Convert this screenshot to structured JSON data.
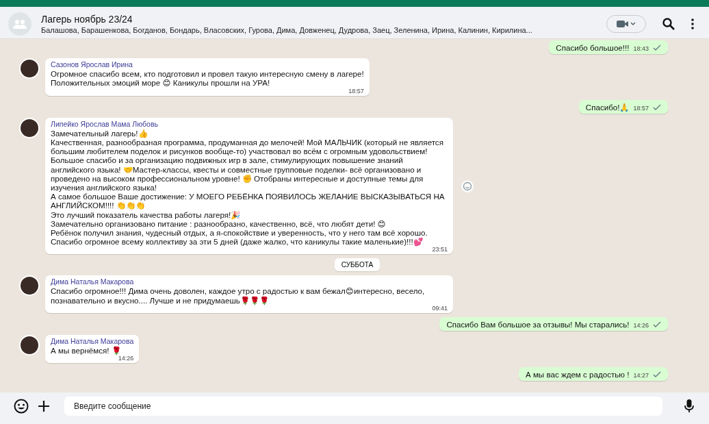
{
  "header": {
    "title": "Лагерь ноябрь 23/24",
    "members": "Балашова, Барашенкова, Богданов, Бондарь, Власовских, Гурова, Дима, Довженец, Дудрова, Заец, Зеленина, Ирина, Калинин, Кирилина..."
  },
  "messages": [
    {
      "kind": "outgoing",
      "text": "Спасибо большое!!!",
      "time": "18:43",
      "read": false
    },
    {
      "kind": "incoming",
      "sender": "Сазонов Ярослав Ирина",
      "text": "Огромное спасибо всем, кто подготовил и провел такую интересную смену в лагере!\nПоложительных эмоций море 😊 Каникулы прошли на УРА!",
      "time": "18:57"
    },
    {
      "kind": "outgoing",
      "text": "Спасибо!🙏",
      "time": "18:57",
      "read": false
    },
    {
      "kind": "incoming",
      "sender": "Липейко Ярослав Мама Любовь",
      "text": "Замечательный лагерь!👍\nКачественная, разнообразная программа, продуманная до мелочей! Мой МАЛЬЧИК (который не является большим любителем поделок и рисунков вообще-то) участвовал во всём с огромным удовольствием! Большое спасибо и за организацию подвижных игр в зале, стимулирующих повышение знаний английского языка!  🤝Мастер-классы, квесты и совместные групповые поделки- всё организовано и проведено на высоком профессиональном уровне! ✊ Отобраны интересные и доступные темы для изучения английского языка!\nА самое большое Ваше достижение: У МОЕГО РЕБЁНКА ПОЯВИЛОСЬ ЖЕЛАНИЕ ВЫСКАЗЫВАТЬСЯ НА АНГЛИЙСКОМ!!!! 👏👏👏\nЭто  лучший показатель качества работы лагеря!🎉\nЗамечательно организовано питание : разнообразно, качественно, всё, что любят дети! 😊\nРебёнок получил знания, чудесный отдых, а я-спокойствие и уверенность, что у него там всё хорошо.\nСпасибо огромное всему коллективу за эти 5 дней (даже жалко, что каникулы  такие маленькие)!!!💕",
      "time": "23:51"
    },
    {
      "kind": "date",
      "text": "СУББОТА"
    },
    {
      "kind": "incoming",
      "sender": "Дима Наталья Макарова",
      "text": "Спасибо огромное!!! Дима очень доволен, каждое утро с радостью к вам бежал😊интересно, весело, познавательно и вкусно.... Лучше и не придумаешь🌹🌹🌹",
      "time": "09:41"
    },
    {
      "kind": "outgoing",
      "text": "Спасибо Вам большое за отзывы! Мы старались!",
      "time": "14:26",
      "read": false
    },
    {
      "kind": "incoming",
      "sender": "Дима Наталья Макарова",
      "text": "А мы вернёмся! 🌹",
      "time": "14:26"
    },
    {
      "kind": "outgoing",
      "text": "А мы вас ждем с радостью !",
      "time": "14:27",
      "read": false
    }
  ],
  "composer": {
    "placeholder": "Введите сообщение"
  }
}
